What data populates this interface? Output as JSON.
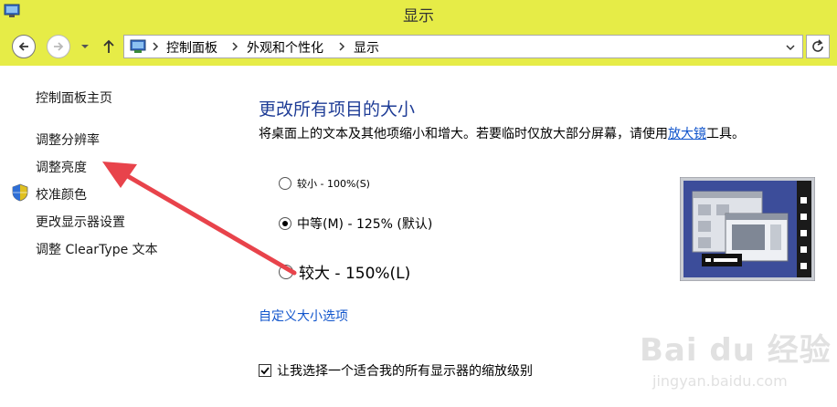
{
  "window": {
    "title": "显示"
  },
  "address": {
    "crumbs": [
      "控制面板",
      "外观和个性化",
      "显示"
    ]
  },
  "sidebar": {
    "items": [
      {
        "label": "控制面板主页"
      },
      {
        "label": "调整分辨率"
      },
      {
        "label": "调整亮度"
      },
      {
        "label": "校准颜色"
      },
      {
        "label": "更改显示器设置"
      },
      {
        "label": "调整 ClearType 文本"
      }
    ]
  },
  "main": {
    "heading": "更改所有项目的大小",
    "description_before": "将桌面上的文本及其他项缩小和增大。若要临时仅放大部分屏幕，请使用",
    "description_link": "放大镜",
    "description_after": "工具。",
    "options": [
      {
        "label": "较小 - 100%(S)",
        "selected": false
      },
      {
        "label": "中等(M) - 125% (默认)",
        "selected": true
      },
      {
        "label": "较大 - 150%(L)",
        "selected": false
      }
    ],
    "custom_link": "自定义大小选项",
    "checkbox_label": "让我选择一个适合我的所有显示器的缩放级别",
    "checkbox_checked": true
  },
  "watermark": {
    "logo": "Bai du 经验",
    "url": "jingyan.baidu.com"
  },
  "colors": {
    "titlebar": "#e6ec47",
    "heading": "#1e3c96",
    "link": "#1155cc",
    "arrow": "#e8434b"
  }
}
